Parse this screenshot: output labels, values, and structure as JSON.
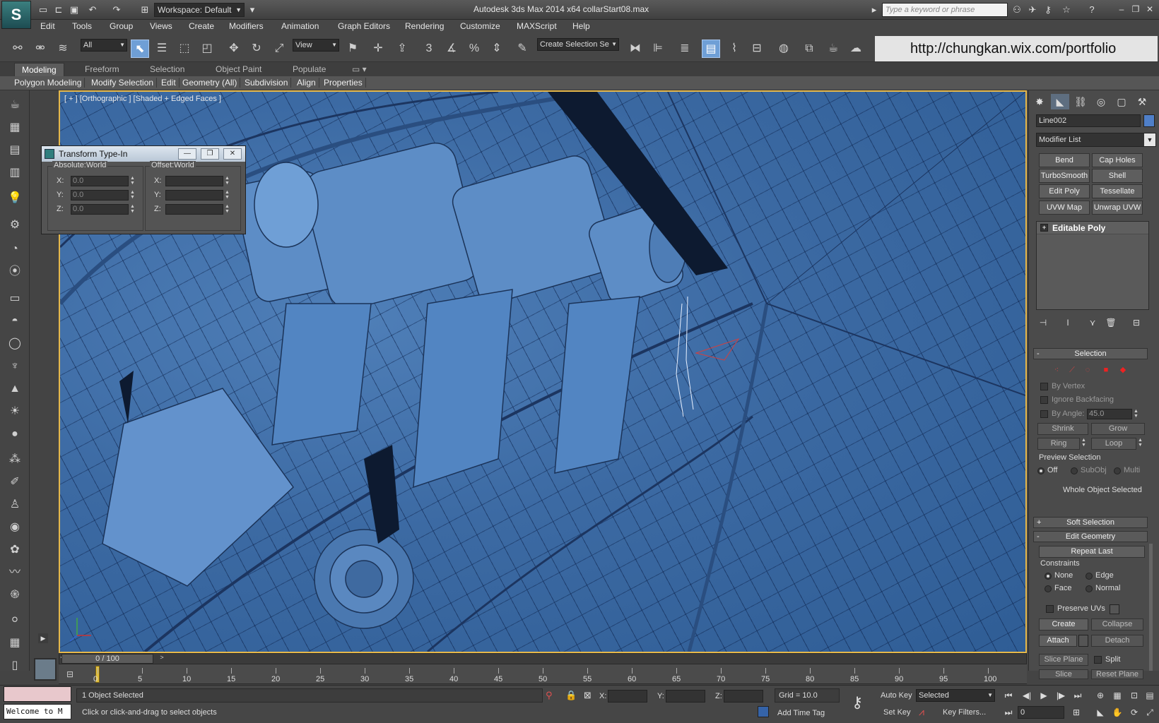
{
  "titlebar": {
    "workspace": "Workspace: Default",
    "title": "Autodesk 3ds Max  2014 x64       collarStart08.max",
    "search_placeholder": "Type a keyword or phrase"
  },
  "menu": [
    "Edit",
    "Tools",
    "Group",
    "Views",
    "Create",
    "Modifiers",
    "Animation",
    "Graph Editors",
    "Rendering",
    "Customize",
    "MAXScript",
    "Help"
  ],
  "toolbar": {
    "selection_filter": "All",
    "ref_coord": "View",
    "named_selection": "Create Selection Se",
    "snap_3": "3",
    "url": "http://chungkan.wix.com/portfolio"
  },
  "ribbon": {
    "tabs": [
      "Modeling",
      "Freeform",
      "Selection",
      "Object Paint",
      "Populate"
    ],
    "active_tab": 0,
    "sub": [
      "Polygon Modeling",
      "Modify Selection",
      "Edit",
      "Geometry (All)",
      "Subdivision",
      "Align",
      "Properties"
    ]
  },
  "viewport": {
    "label": "[ + ] [Orthographic ] [Shaded + Edged Faces ]"
  },
  "transform_typein": {
    "title": "Transform Type-In",
    "absolute_title": "Absolute:World",
    "offset_title": "Offset:World",
    "x_label": "X:",
    "y_label": "Y:",
    "z_label": "Z:",
    "abs_x": "0.0",
    "abs_y": "0.0",
    "abs_z": "0.0"
  },
  "command_panel": {
    "object_name": "Line002",
    "object_color": "#4f7fc8",
    "modifier_list": "Modifier List",
    "modifier_buttons": [
      "Bend",
      "Cap Holes",
      "TurboSmooth",
      "Shell",
      "Edit Poly",
      "Tessellate",
      "UVW Map",
      "Unwrap UVW"
    ],
    "stack_item": "Editable Poly",
    "selection": {
      "title": "Selection",
      "by_vertex": "By Vertex",
      "ignore_backfacing": "Ignore Backfacing",
      "by_angle": "By Angle:",
      "angle_value": "45.0",
      "shrink": "Shrink",
      "grow": "Grow",
      "ring": "Ring",
      "loop": "Loop",
      "preview_title": "Preview Selection",
      "preview_off": "Off",
      "preview_subobj": "SubObj",
      "preview_multi": "Multi",
      "status": "Whole Object Selected"
    },
    "soft_selection": "Soft Selection",
    "edit_geometry": {
      "title": "Edit Geometry",
      "repeat_last": "Repeat Last",
      "constraints_title": "Constraints",
      "none": "None",
      "edge": "Edge",
      "face": "Face",
      "normal": "Normal",
      "preserve_uvs": "Preserve UVs",
      "create": "Create",
      "collapse": "Collapse",
      "attach": "Attach",
      "detach": "Detach",
      "slice_plane": "Slice Plane",
      "split": "Split",
      "slice": "Slice",
      "reset_plane": "Reset Plane"
    }
  },
  "timeline": {
    "position": "0 / 100",
    "ticks": [
      "0",
      "5",
      "10",
      "15",
      "20",
      "25",
      "30",
      "35",
      "40",
      "45",
      "50",
      "55",
      "60",
      "65",
      "70",
      "75",
      "80",
      "85",
      "90",
      "95",
      "100"
    ]
  },
  "status": {
    "maxscript": "Welcome to M",
    "selected": "1 Object Selected",
    "prompt": "Click or click-and-drag to select objects",
    "x_label": "X:",
    "y_label": "Y:",
    "z_label": "Z:",
    "grid": "Grid = 10.0",
    "add_time_tag": "Add Time Tag",
    "auto_key": "Auto Key",
    "set_key": "Set Key",
    "key_mode": "Selected",
    "key_filters": "Key Filters...",
    "frame": "0"
  }
}
